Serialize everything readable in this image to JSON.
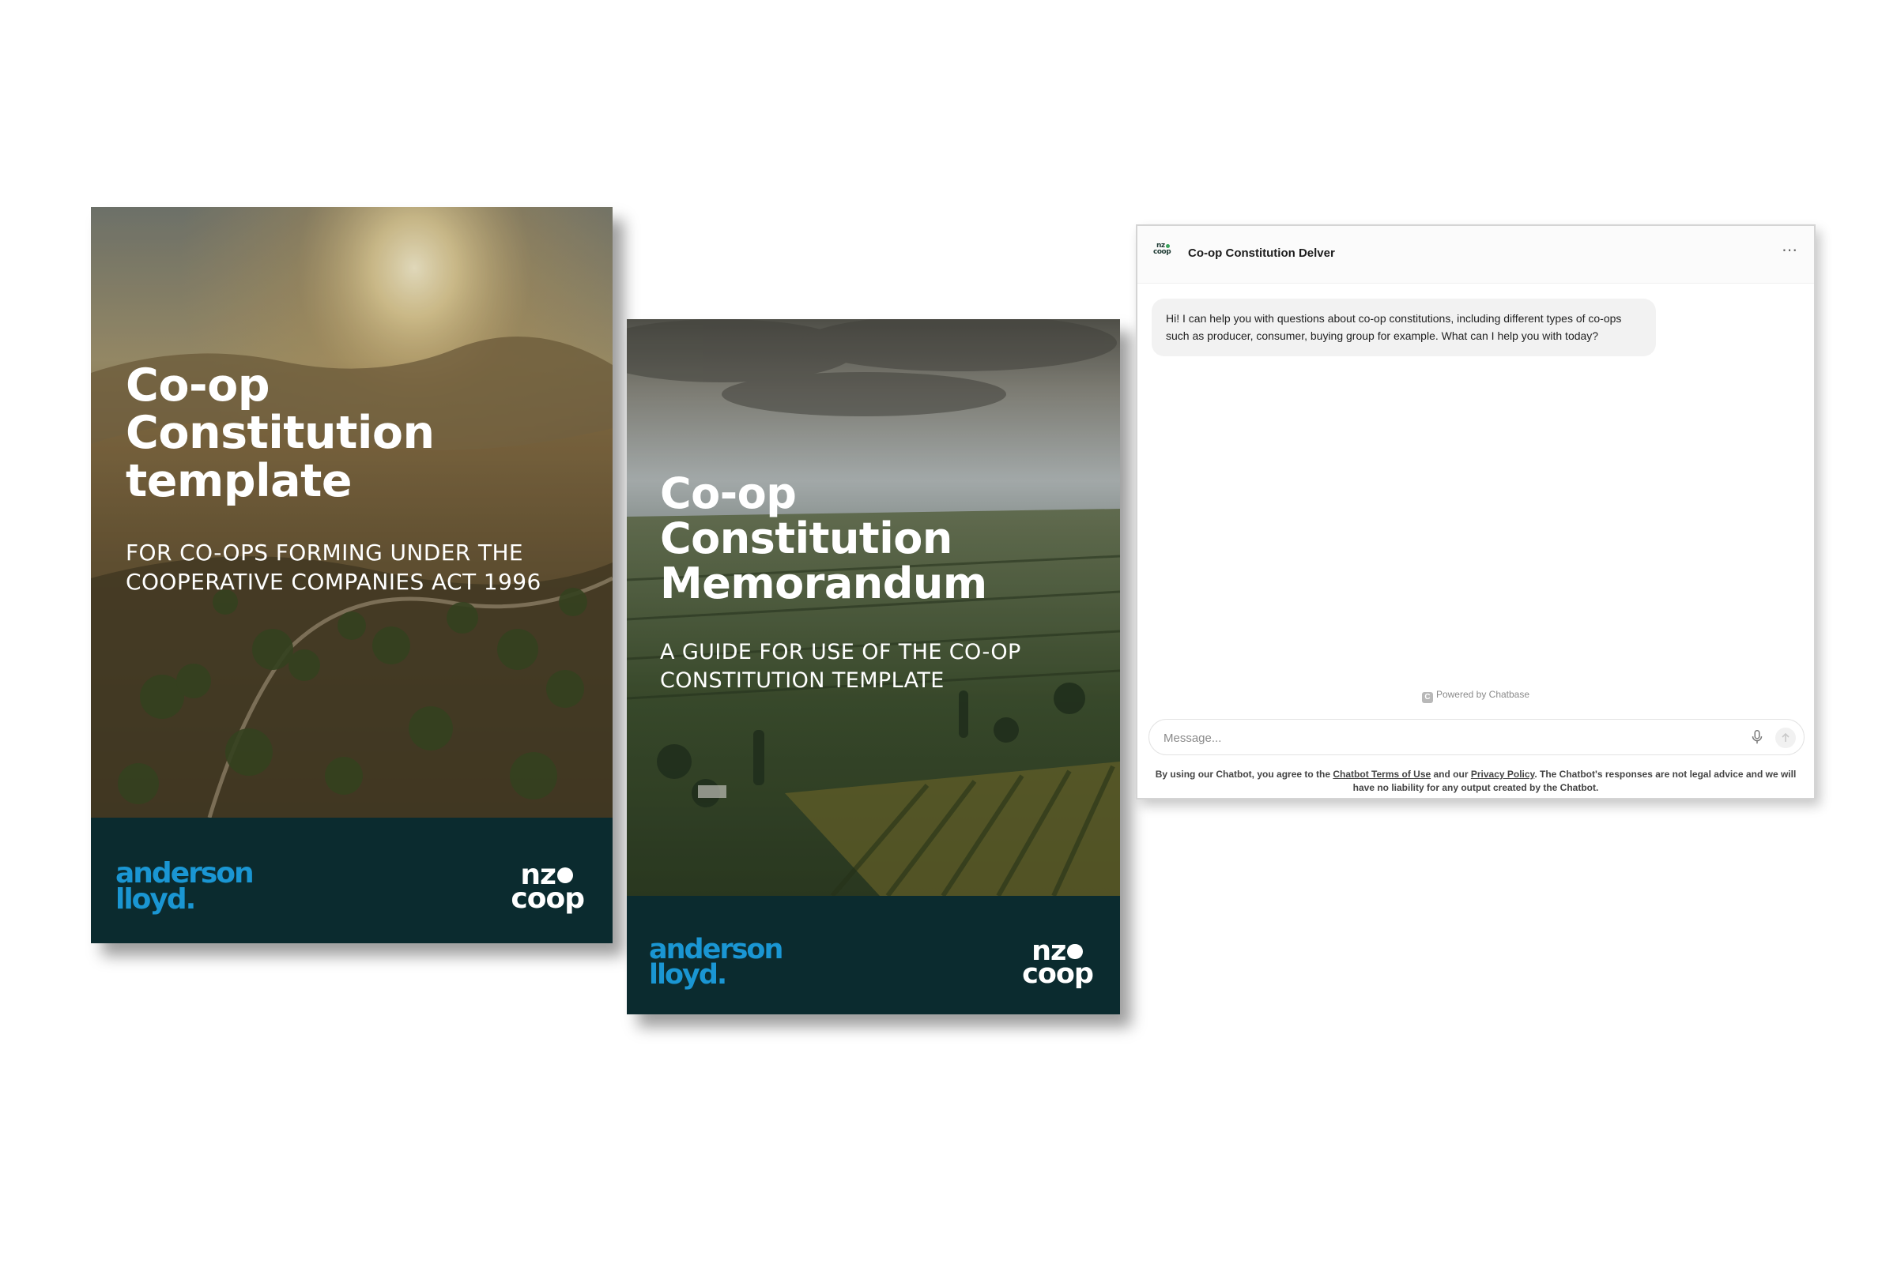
{
  "brochures": [
    {
      "title_lines": [
        "Co-op",
        "Constitution",
        "template"
      ],
      "subtitle_lines": [
        "For co-ops forming under the",
        "Cooperative Companies Act 1996"
      ],
      "logo_left": [
        "anderson",
        "lloyd."
      ],
      "logo_right": [
        "nz",
        "coop"
      ]
    },
    {
      "title_lines": [
        "Co-op",
        "Constitution",
        "Memorandum"
      ],
      "subtitle_lines": [
        "A guide for use of the co-op",
        "constitution template"
      ],
      "logo_left": [
        "anderson",
        "lloyd."
      ],
      "logo_right": [
        "nz",
        "coop"
      ]
    }
  ],
  "chatbot": {
    "avatar_text": [
      "nz",
      "coop"
    ],
    "title": "Co-op Constitution Delver",
    "menu_icon": "ellipsis-icon",
    "greeting": "Hi! I can help you with questions about co-op constitutions, including different types of co-ops such as producer, consumer, buying group for example. What can I help you with today?",
    "powered_by": "Powered by Chatbase",
    "powered_logo": "C",
    "input_placeholder": "Message...",
    "input_value": "",
    "mic_icon": "microphone-icon",
    "send_icon": "send-icon",
    "disclaimer": {
      "prefix": "By using our Chatbot, you agree to the ",
      "terms_link": "Chatbot Terms of Use",
      "middle": " and our ",
      "privacy_link": "Privacy Policy",
      "suffix": ". The Chatbot's responses are not legal advice and we will have no liability for any output created by the Chatbot."
    }
  },
  "colors": {
    "cover_footer": "#0b2b2f",
    "anderson_lloyd_blue": "#1a96d3",
    "bubble_bg": "#f2f2f2"
  }
}
